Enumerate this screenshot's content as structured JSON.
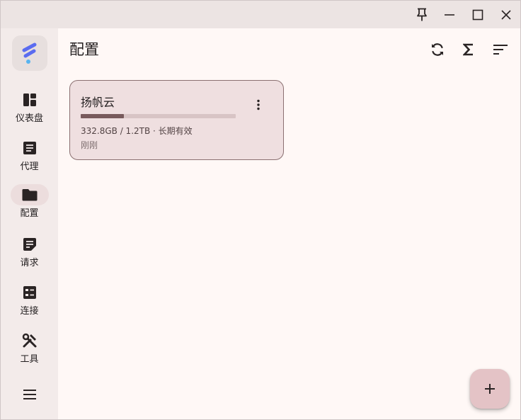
{
  "window": {
    "controls": [
      "pin-icon",
      "minimize-icon",
      "maximize-icon",
      "close-icon"
    ]
  },
  "sidebar": {
    "items": [
      {
        "label": "仪表盘",
        "icon": "dashboard-icon",
        "active": false
      },
      {
        "label": "代理",
        "icon": "article-icon",
        "active": false
      },
      {
        "label": "配置",
        "icon": "folder-icon",
        "active": true
      },
      {
        "label": "请求",
        "icon": "notes-icon",
        "active": false
      },
      {
        "label": "连接",
        "icon": "connections-icon",
        "active": false
      },
      {
        "label": "工具",
        "icon": "tools-icon",
        "active": false
      }
    ],
    "menu_icon": "menu-icon"
  },
  "header": {
    "title": "配置",
    "actions": [
      "sync-icon",
      "sum-icon",
      "sort-icon"
    ]
  },
  "profiles": [
    {
      "name": "扬帆云",
      "usage_text": "332.8GB / 1.2TB · 长期有效",
      "usage_fraction": 0.277,
      "updated": "刚刚"
    }
  ],
  "fab": {
    "icon": "add-icon"
  },
  "colors": {
    "accent": "#785a5c",
    "card_bg": "#efdfe0",
    "logo_blue": "#5b6cf0",
    "logo_light": "#58b4f0"
  }
}
